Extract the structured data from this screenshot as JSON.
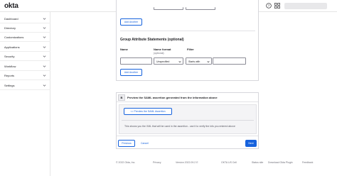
{
  "header": {
    "logo": "okta",
    "search_placeholder": "Search..."
  },
  "sidebar": {
    "items": [
      {
        "label": "Dashboard"
      },
      {
        "label": "Directory"
      },
      {
        "label": "Customizations"
      },
      {
        "label": "Applications"
      },
      {
        "label": "Security"
      },
      {
        "label": "Workflow"
      },
      {
        "label": "Reports"
      },
      {
        "label": "Settings"
      }
    ]
  },
  "attribute_statements": {
    "add_another": "Add Another"
  },
  "group_attributes": {
    "title": "Group Attribute Statements (optional)",
    "col_name": "Name",
    "col_format": "Name format",
    "col_format_sub": "(optional)",
    "col_filter": "Filter",
    "format_value": "Unspecified",
    "filter_value": "Starts with",
    "add_another": "Add Another"
  },
  "section_b": {
    "badge": "B",
    "title": "Preview the SAML assertion generated from the information above",
    "preview_button": "<> Preview the SAML Assertion",
    "help_text": "This shows you the XML that will be used in the assertion - use it to verify the info you entered above"
  },
  "actions": {
    "previous": "Previous",
    "cancel": "Cancel",
    "next": "Next"
  },
  "footer": {
    "copyright": "© 2022 Okta, Inc.",
    "privacy": "Privacy",
    "version": "Version 2022.09.2 E",
    "cell": "OKTA US Cell",
    "status": "Status site",
    "plugin": "Download Okta Plugin",
    "feedback": "Feedback"
  },
  "colors": {
    "accent": "#1662dd",
    "border": "#d7d7dc",
    "muted_text": "#6e6e78"
  }
}
